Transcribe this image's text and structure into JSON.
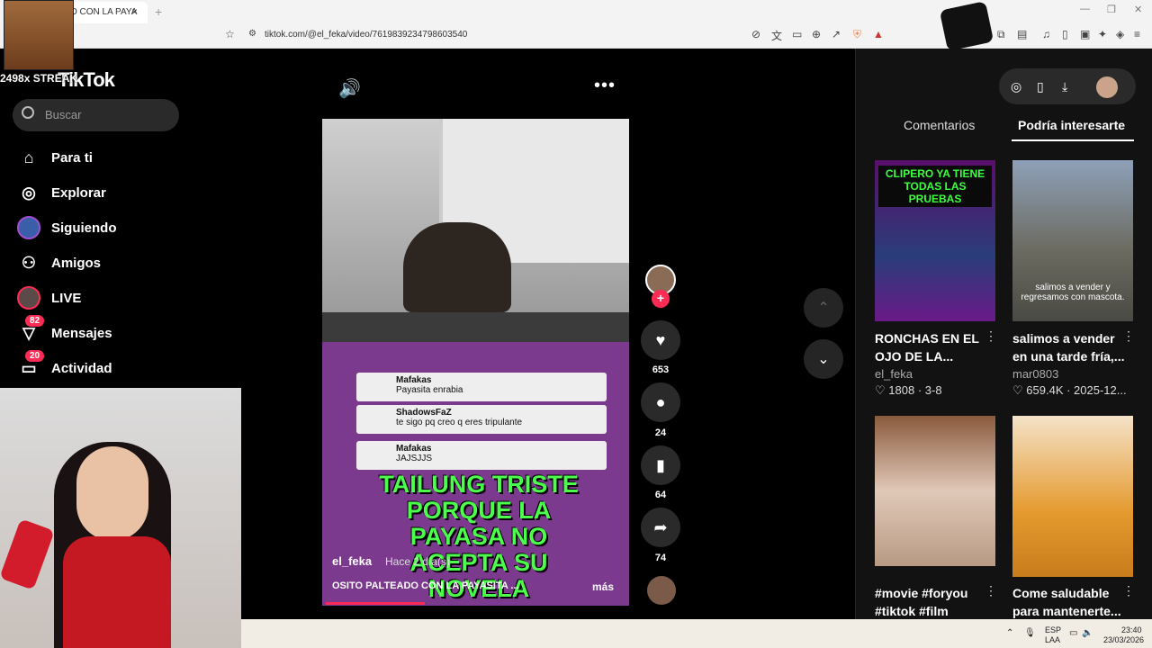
{
  "browser": {
    "tab_title": "O CON LA PAYA",
    "tab_close": "×",
    "new_tab": "+",
    "url": "tiktok.com/@el_feka/video/7619839234798603540"
  },
  "overlay": {
    "streak": "2498x STREAK"
  },
  "app": {
    "logo": "TikTok",
    "search_placeholder": "Buscar"
  },
  "sidebar": {
    "items": [
      {
        "label": "Para ti",
        "icon": "home-icon"
      },
      {
        "label": "Explorar",
        "icon": "compass-icon"
      },
      {
        "label": "Siguiendo",
        "icon": "following-icon"
      },
      {
        "label": "Amigos",
        "icon": "friends-icon"
      },
      {
        "label": "LIVE",
        "icon": "live-icon"
      },
      {
        "label": "Mensajes",
        "icon": "messages-icon",
        "badge": "82"
      },
      {
        "label": "Actividad",
        "icon": "activity-icon",
        "badge": "20"
      }
    ]
  },
  "video": {
    "chat_messages": [
      {
        "user": "Mafakas",
        "text": "Payasita enrabia"
      },
      {
        "user": "ShadowsFaZ",
        "text": "te sigo pq creo q eres tripulante"
      },
      {
        "user": "Mafakas",
        "text": "JAJSJJS"
      }
    ],
    "caption": "TAILUNG TRISTE PORQUE LA PAYASA NO ACEPTA SU NOVELA",
    "author": "el_feka",
    "posted": "Hace 2 día(s)",
    "description": "OSITO PALTEADO CON LA PAYASITA ...",
    "more": "más",
    "progress": 0.33
  },
  "actions": {
    "likes": "653",
    "comments": "24",
    "saves": "64",
    "shares": "74"
  },
  "right_panel": {
    "tab_comments": "Comentarios",
    "tab_recommended": "Podría interesarte",
    "cards": [
      {
        "thumb_text": "CLIPERO YA TIENE TODAS LAS PRUEBAS",
        "title": "RONCHAS EN EL OJO DE LA...",
        "author": "el_feka",
        "stats": "1808 · 3-8"
      },
      {
        "thumb_text": "salimos a vender y regresamos con mascota.",
        "title": "salimos a vender en una tarde fría,...",
        "author": "mar0803",
        "stats": "659.4K · 2025-12..."
      },
      {
        "thumb_text": "",
        "title": "#movie #foryou #tiktok #film",
        "author": "",
        "stats": ""
      },
      {
        "thumb_text": "",
        "title": "Come saludable para mantenerte...",
        "author": "",
        "stats": ""
      }
    ]
  },
  "taskbar": {
    "lang": "ESP",
    "lang2": "LAA",
    "time": "23:40",
    "date": "23/03/2026"
  },
  "colors": {
    "accent": "#fe2c55",
    "caption": "#4cff4c"
  }
}
